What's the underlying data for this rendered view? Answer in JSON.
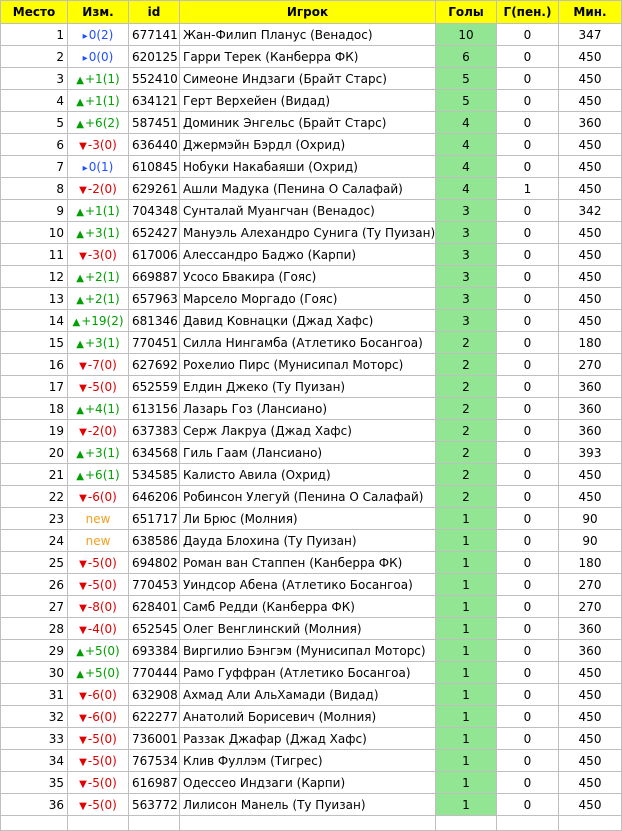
{
  "colors": {
    "header_bg": "#ffff00",
    "goals_highlight": "#92e592",
    "up": "#00a000",
    "down": "#e00000",
    "same": "#1f4fff",
    "new": "#f0a020"
  },
  "icons": {
    "up": "triangle-up-icon",
    "down": "triangle-down-icon",
    "same": "flag-right-icon"
  },
  "headers": {
    "place": "Место",
    "change": "Изм.",
    "id": "id",
    "player": "Игрок",
    "goals": "Голы",
    "penalties": "Г(пен.)",
    "minutes": "Мин."
  },
  "rows": [
    {
      "place": "1",
      "dir": "same",
      "change": "0(2)",
      "id": "677141",
      "player": "Жан-Филип Планус (Венадос)",
      "goals": "10",
      "pen": "0",
      "mins": "347"
    },
    {
      "place": "2",
      "dir": "same",
      "change": "0(0)",
      "id": "620125",
      "player": "Гарри Терек (Канберра ФК)",
      "goals": "6",
      "pen": "0",
      "mins": "450"
    },
    {
      "place": "3",
      "dir": "up",
      "change": "+1(1)",
      "id": "552410",
      "player": "Симеоне Индзаги (Брайт Старс)",
      "goals": "5",
      "pen": "0",
      "mins": "450"
    },
    {
      "place": "4",
      "dir": "up",
      "change": "+1(1)",
      "id": "634121",
      "player": "Герт Верхейен (Видад)",
      "goals": "5",
      "pen": "0",
      "mins": "450"
    },
    {
      "place": "5",
      "dir": "up",
      "change": "+6(2)",
      "id": "587451",
      "player": "Доминик Энгельс (Брайт Старс)",
      "goals": "4",
      "pen": "0",
      "mins": "360"
    },
    {
      "place": "6",
      "dir": "down",
      "change": "-3(0)",
      "id": "636440",
      "player": "Джермэйн Бэрдл (Охрид)",
      "goals": "4",
      "pen": "0",
      "mins": "450"
    },
    {
      "place": "7",
      "dir": "same",
      "change": "0(1)",
      "id": "610845",
      "player": "Нобуки Накабаяши (Охрид)",
      "goals": "4",
      "pen": "0",
      "mins": "450"
    },
    {
      "place": "8",
      "dir": "down",
      "change": "-2(0)",
      "id": "629261",
      "player": "Ашли Мадука (Пенина О Салафай)",
      "goals": "4",
      "pen": "1",
      "mins": "450"
    },
    {
      "place": "9",
      "dir": "up",
      "change": "+1(1)",
      "id": "704348",
      "player": "Сунталай Муангчан (Венадос)",
      "goals": "3",
      "pen": "0",
      "mins": "342"
    },
    {
      "place": "10",
      "dir": "up",
      "change": "+3(1)",
      "id": "652427",
      "player": "Мануэль Алехандро Сунига (Ту Пуизан)",
      "goals": "3",
      "pen": "0",
      "mins": "450"
    },
    {
      "place": "11",
      "dir": "down",
      "change": "-3(0)",
      "id": "617006",
      "player": "Алессандро Баджо (Карпи)",
      "goals": "3",
      "pen": "0",
      "mins": "450"
    },
    {
      "place": "12",
      "dir": "up",
      "change": "+2(1)",
      "id": "669887",
      "player": "Усосо Бвакира (Гояс)",
      "goals": "3",
      "pen": "0",
      "mins": "450"
    },
    {
      "place": "13",
      "dir": "up",
      "change": "+2(1)",
      "id": "657963",
      "player": "Марсело Моргадо (Гояс)",
      "goals": "3",
      "pen": "0",
      "mins": "450"
    },
    {
      "place": "14",
      "dir": "up",
      "change": "+19(2)",
      "id": "681346",
      "player": "Давид Ковнацки (Джад Хафс)",
      "goals": "3",
      "pen": "0",
      "mins": "450"
    },
    {
      "place": "15",
      "dir": "up",
      "change": "+3(1)",
      "id": "770451",
      "player": "Силла Нингамба (Атлетико Босангоа)",
      "goals": "2",
      "pen": "0",
      "mins": "180"
    },
    {
      "place": "16",
      "dir": "down",
      "change": "-7(0)",
      "id": "627692",
      "player": "Рохелио Пирс (Мунисипал Моторс)",
      "goals": "2",
      "pen": "0",
      "mins": "270"
    },
    {
      "place": "17",
      "dir": "down",
      "change": "-5(0)",
      "id": "652559",
      "player": "Елдин Джеко (Ту Пуизан)",
      "goals": "2",
      "pen": "0",
      "mins": "360"
    },
    {
      "place": "18",
      "dir": "up",
      "change": "+4(1)",
      "id": "613156",
      "player": "Лазарь Гоз (Лансиано)",
      "goals": "2",
      "pen": "0",
      "mins": "360"
    },
    {
      "place": "19",
      "dir": "down",
      "change": "-2(0)",
      "id": "637383",
      "player": "Серж Лакруа (Джад Хафс)",
      "goals": "2",
      "pen": "0",
      "mins": "360"
    },
    {
      "place": "20",
      "dir": "up",
      "change": "+3(1)",
      "id": "634568",
      "player": "Гиль Гаам (Лансиано)",
      "goals": "2",
      "pen": "0",
      "mins": "393"
    },
    {
      "place": "21",
      "dir": "up",
      "change": "+6(1)",
      "id": "534585",
      "player": "Калисто Авила (Охрид)",
      "goals": "2",
      "pen": "0",
      "mins": "450"
    },
    {
      "place": "22",
      "dir": "down",
      "change": "-6(0)",
      "id": "646206",
      "player": "Робинсон Улегуй (Пенина О Салафай)",
      "goals": "2",
      "pen": "0",
      "mins": "450"
    },
    {
      "place": "23",
      "dir": "new",
      "change": "new",
      "id": "651717",
      "player": "Ли Брюс (Молния)",
      "goals": "1",
      "pen": "0",
      "mins": "90"
    },
    {
      "place": "24",
      "dir": "new",
      "change": "new",
      "id": "638586",
      "player": "Дауда Блохина (Ту Пуизан)",
      "goals": "1",
      "pen": "0",
      "mins": "90"
    },
    {
      "place": "25",
      "dir": "down",
      "change": "-5(0)",
      "id": "694802",
      "player": "Роман ван Стаппен (Канберра ФК)",
      "goals": "1",
      "pen": "0",
      "mins": "180"
    },
    {
      "place": "26",
      "dir": "down",
      "change": "-5(0)",
      "id": "770453",
      "player": "Уиндсор Абена (Атлетико Босангоа)",
      "goals": "1",
      "pen": "0",
      "mins": "270"
    },
    {
      "place": "27",
      "dir": "down",
      "change": "-8(0)",
      "id": "628401",
      "player": "Самб Редди (Канберра ФК)",
      "goals": "1",
      "pen": "0",
      "mins": "270"
    },
    {
      "place": "28",
      "dir": "down",
      "change": "-4(0)",
      "id": "652545",
      "player": "Олег Венглинский (Молния)",
      "goals": "1",
      "pen": "0",
      "mins": "360"
    },
    {
      "place": "29",
      "dir": "up",
      "change": "+5(0)",
      "id": "693384",
      "player": "Виргилио Бэнгэм (Мунисипал Моторс)",
      "goals": "1",
      "pen": "0",
      "mins": "360"
    },
    {
      "place": "30",
      "dir": "up",
      "change": "+5(0)",
      "id": "770444",
      "player": "Рамо Гуффран (Атлетико Босангоа)",
      "goals": "1",
      "pen": "0",
      "mins": "450"
    },
    {
      "place": "31",
      "dir": "down",
      "change": "-6(0)",
      "id": "632908",
      "player": "Ахмад Али АльХамади (Видад)",
      "goals": "1",
      "pen": "0",
      "mins": "450"
    },
    {
      "place": "32",
      "dir": "down",
      "change": "-6(0)",
      "id": "622277",
      "player": "Анатолий Борисевич (Молния)",
      "goals": "1",
      "pen": "0",
      "mins": "450"
    },
    {
      "place": "33",
      "dir": "down",
      "change": "-5(0)",
      "id": "736001",
      "player": "Раззак Джафар (Джад Хафс)",
      "goals": "1",
      "pen": "0",
      "mins": "450"
    },
    {
      "place": "34",
      "dir": "down",
      "change": "-5(0)",
      "id": "767534",
      "player": "Клив Фуллэм (Тигрес)",
      "goals": "1",
      "pen": "0",
      "mins": "450"
    },
    {
      "place": "35",
      "dir": "down",
      "change": "-5(0)",
      "id": "616987",
      "player": "Одессео Индзаги (Карпи)",
      "goals": "1",
      "pen": "0",
      "mins": "450"
    },
    {
      "place": "36",
      "dir": "down",
      "change": "-5(0)",
      "id": "563772",
      "player": "Лилисон Манель (Ту Пуизан)",
      "goals": "1",
      "pen": "0",
      "mins": "450"
    }
  ]
}
